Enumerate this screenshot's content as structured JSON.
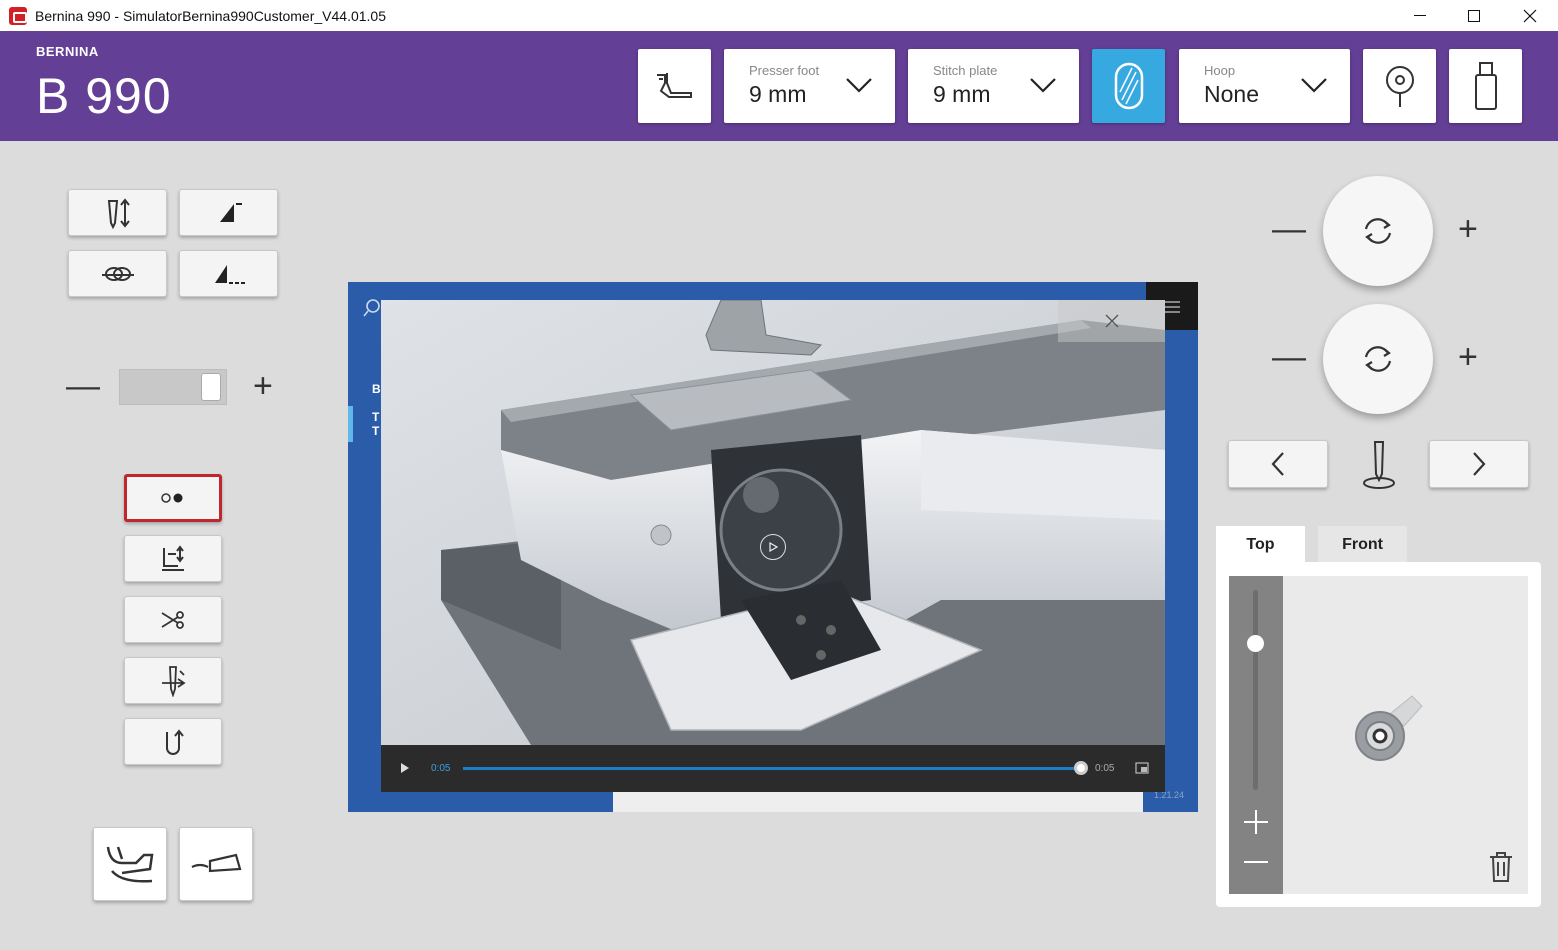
{
  "window": {
    "title": "Bernina 990 - SimulatorBernina990Customer_V44.01.05"
  },
  "header": {
    "brand": "BERNINA",
    "model": "B 990",
    "presser_foot": {
      "label": "Presser foot",
      "value": "9 mm"
    },
    "stitch_plate": {
      "label": "Stitch plate",
      "value": "9 mm"
    },
    "hoop": {
      "label": "Hoop",
      "value": "None"
    },
    "accent_color": "#643f96",
    "active_button_color": "#36a9e1"
  },
  "left_panel": {
    "icons": [
      "needle-up-down-icon",
      "pattern-begin-icon",
      "securing-knot-icon",
      "pattern-end-icon",
      "two-dots-icon",
      "presser-foot-lift-icon",
      "thread-cutter-icon",
      "needle-threader-icon",
      "pattern-repeat-icon",
      "free-hand-system-icon",
      "foot-control-icon"
    ]
  },
  "video": {
    "time_current": "0:05",
    "time_total": "0:05",
    "progress": 1.0,
    "version_hint": "1.21.24",
    "sidebar_letters": [
      "Be",
      "T",
      "T"
    ]
  },
  "right_panel": {
    "tabs": [
      "Top",
      "Front"
    ],
    "active_tab": "Top"
  }
}
